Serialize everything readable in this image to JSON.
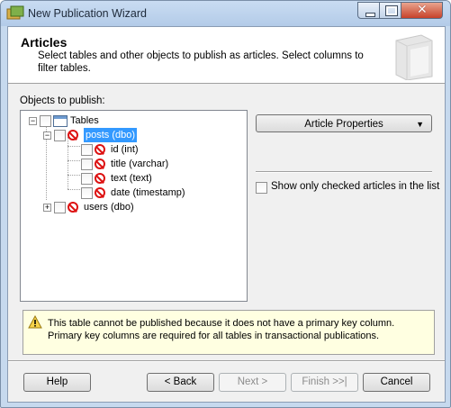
{
  "window": {
    "title": "New Publication Wizard"
  },
  "header": {
    "title": "Articles",
    "description": "Select tables and other objects to publish as articles. Select columns to filter tables."
  },
  "objects_label": "Objects to publish:",
  "tree": {
    "root": {
      "label": "Tables"
    },
    "posts": {
      "label": "posts (dbo)",
      "selected": true
    },
    "columns": [
      {
        "label": "id (int)"
      },
      {
        "label": "title (varchar)"
      },
      {
        "label": "text (text)"
      },
      {
        "label": "date (timestamp)"
      }
    ],
    "users": {
      "label": "users (dbo)"
    }
  },
  "article_properties": {
    "label": "Article Properties"
  },
  "show_checked": {
    "label": "Show only checked articles in the list",
    "checked": false
  },
  "warning": {
    "text": "This table cannot be published because it does not have a primary key column. Primary key columns are required for all tables in transactional publications."
  },
  "buttons": {
    "help": "Help",
    "back": "< Back",
    "next": "Next >",
    "finish": "Finish >>|",
    "cancel": "Cancel"
  },
  "colors": {
    "selection": "#3399ff",
    "warning_bg": "#ffffe1",
    "error_icon": "#dd1111"
  }
}
